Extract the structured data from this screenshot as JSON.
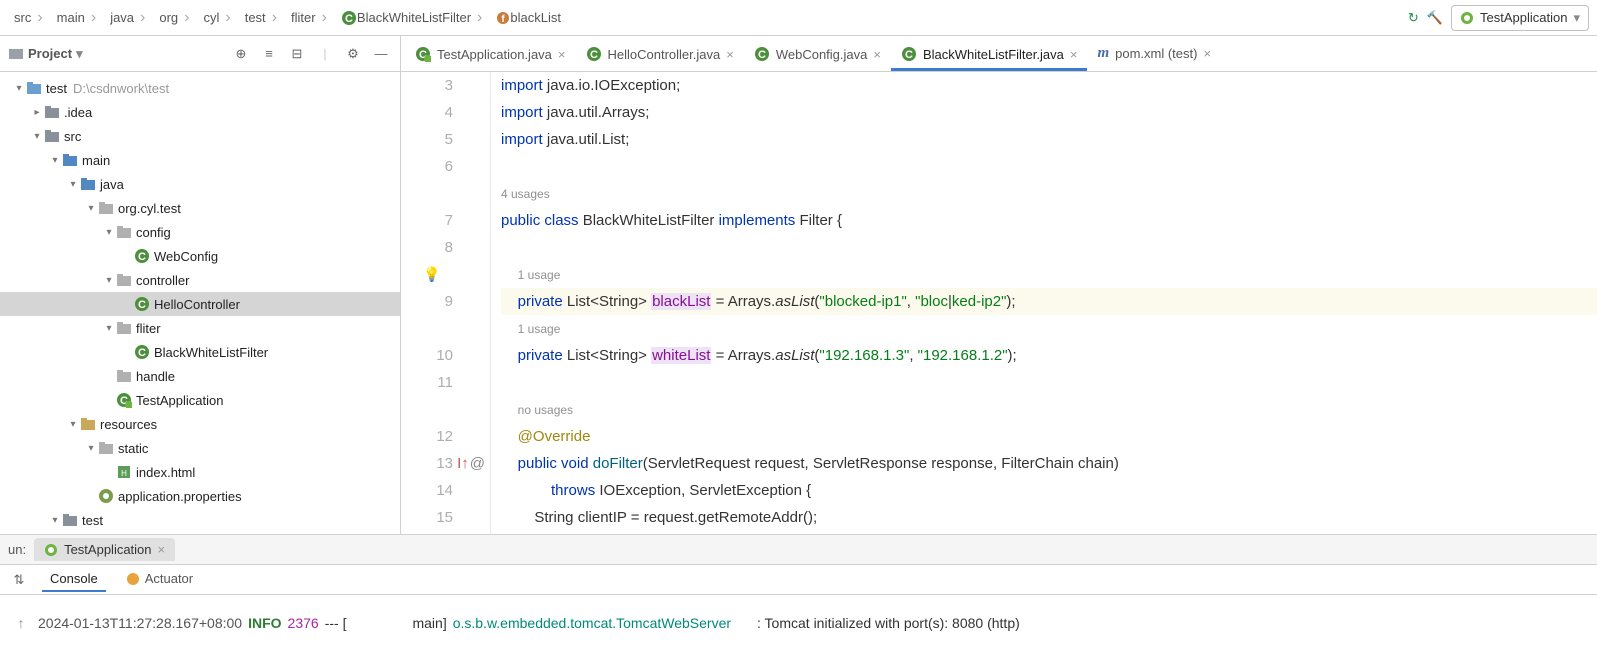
{
  "breadcrumb": [
    "src",
    "main",
    "java",
    "org",
    "cyl",
    "test",
    "fliter",
    "BlackWhiteListFilter",
    "blackList"
  ],
  "breadcrumb_icon_at": 7,
  "breadcrumb_field_at": 8,
  "run_config": "TestApplication",
  "project_panel": {
    "title": "Project"
  },
  "tree": [
    {
      "depth": 0,
      "arrow": "down",
      "icon": "module",
      "label": "test",
      "extra": "D:\\csdnwork\\test"
    },
    {
      "depth": 1,
      "arrow": "right",
      "icon": "folder",
      "label": ".idea"
    },
    {
      "depth": 1,
      "arrow": "down",
      "icon": "folder",
      "label": "src"
    },
    {
      "depth": 2,
      "arrow": "down",
      "icon": "folder-src",
      "label": "main"
    },
    {
      "depth": 3,
      "arrow": "down",
      "icon": "folder-src",
      "label": "java"
    },
    {
      "depth": 4,
      "arrow": "down",
      "icon": "folder-pkg",
      "label": "org.cyl.test"
    },
    {
      "depth": 5,
      "arrow": "down",
      "icon": "folder-pkg",
      "label": "config"
    },
    {
      "depth": 6,
      "arrow": "",
      "icon": "class",
      "label": "WebConfig"
    },
    {
      "depth": 5,
      "arrow": "down",
      "icon": "folder-pkg",
      "label": "controller"
    },
    {
      "depth": 6,
      "arrow": "",
      "icon": "class",
      "label": "HelloController",
      "sel": true
    },
    {
      "depth": 5,
      "arrow": "down",
      "icon": "folder-pkg",
      "label": "fliter"
    },
    {
      "depth": 6,
      "arrow": "",
      "icon": "class",
      "label": "BlackWhiteListFilter"
    },
    {
      "depth": 5,
      "arrow": "",
      "icon": "folder-pkg",
      "label": "handle"
    },
    {
      "depth": 5,
      "arrow": "",
      "icon": "spring",
      "label": "TestApplication"
    },
    {
      "depth": 3,
      "arrow": "down",
      "icon": "folder-res",
      "label": "resources"
    },
    {
      "depth": 4,
      "arrow": "down",
      "icon": "folder-pkg",
      "label": "static"
    },
    {
      "depth": 5,
      "arrow": "",
      "icon": "html",
      "label": "index.html"
    },
    {
      "depth": 4,
      "arrow": "",
      "icon": "props",
      "label": "application.properties"
    },
    {
      "depth": 2,
      "arrow": "down",
      "icon": "folder",
      "label": "test"
    }
  ],
  "editor_tabs": [
    {
      "icon": "spring",
      "label": "TestApplication.java"
    },
    {
      "icon": "class",
      "label": "HelloController.java"
    },
    {
      "icon": "class",
      "label": "WebConfig.java"
    },
    {
      "icon": "class",
      "label": "BlackWhiteListFilter.java",
      "active": true
    },
    {
      "icon": "maven",
      "label": "pom.xml (test)"
    }
  ],
  "code_lines": [
    {
      "n": 3,
      "html": "<span class='kw'>import</span> java.io.IOException;"
    },
    {
      "n": 4,
      "html": "<span class='kw'>import</span> java.util.Arrays;"
    },
    {
      "n": 5,
      "html": "<span class='kw'>import</span> java.util.List;"
    },
    {
      "n": 6,
      "html": ""
    },
    {
      "n": "",
      "html": "<span class='usage'>4 usages</span>"
    },
    {
      "n": 7,
      "html": "<span class='kw'>public class</span> BlackWhiteListFilter <span class='kw'>implements</span> Filter {"
    },
    {
      "n": 8,
      "html": ""
    },
    {
      "n": "",
      "html": "    <span class='usage'>1 usage</span>",
      "bulb": true
    },
    {
      "n": 9,
      "hl": true,
      "html": "    <span class='kw'>private</span> List&lt;String&gt; <span class='field'>blackList</span> = Arrays.<span class='it'>asList</span>(<span class='str'>\"blocked-ip1\"</span>, <span class='str'>\"bloc</span>|<span class='str'>ked-ip2\"</span>);"
    },
    {
      "n": "",
      "html": "    <span class='usage'>1 usage</span>"
    },
    {
      "n": 10,
      "html": "    <span class='kw'>private</span> List&lt;String&gt; <span class='field'>whiteList</span> = Arrays.<span class='it'>asList</span>(<span class='str'>\"192.168.1.3\"</span>, <span class='str'>\"192.168.1.2\"</span>);"
    },
    {
      "n": 11,
      "html": ""
    },
    {
      "n": "",
      "html": "    <span class='usage'>no usages</span>"
    },
    {
      "n": 12,
      "html": "    <span class='ann'>@Override</span>"
    },
    {
      "n": 13,
      "gut": "↑@",
      "html": "    <span class='kw'>public void</span> <span style='color:#00627a'>doFilter</span>(ServletRequest request, ServletResponse response, FilterChain chain)"
    },
    {
      "n": 14,
      "html": "            <span class='kw'>throws</span> IOException, ServletException {"
    },
    {
      "n": 15,
      "html": "        String clientIP = request.getRemoteAddr();"
    }
  ],
  "bottom": {
    "run_label": "TestApplication",
    "tabs": [
      "Console",
      "Actuator"
    ],
    "log": {
      "time": "2024-01-13T11:27:28.167+08:00",
      "level": "INFO",
      "pid": "2376",
      "sep": "--- [",
      "thread": "main]",
      "source": "o.s.b.w.embedded.tomcat.TomcatWebServer",
      "msg": ": Tomcat initialized with port(s): 8080 (http)"
    }
  }
}
